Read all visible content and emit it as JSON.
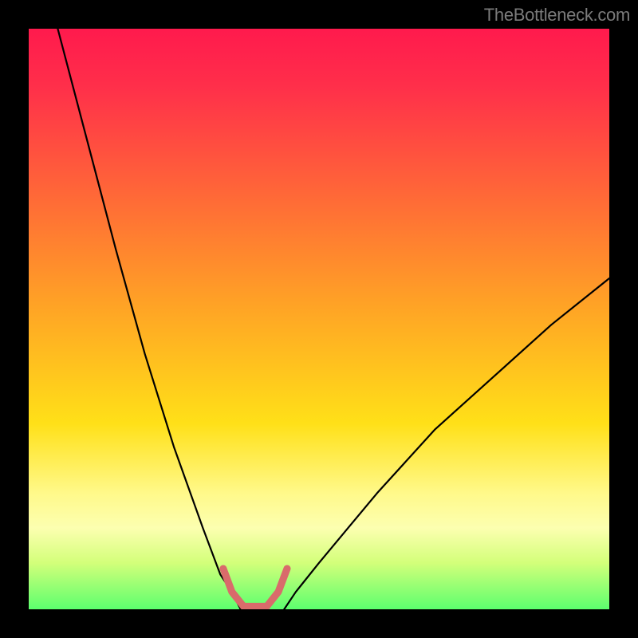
{
  "watermark": "TheBottleneck.com",
  "chart_data": {
    "type": "line",
    "title": "",
    "xlabel": "",
    "ylabel": "",
    "xlim": [
      0,
      100
    ],
    "ylim": [
      0,
      100
    ],
    "grid": false,
    "legend": false,
    "note": "Axes have no visible numeric ticks or labels; values below are estimated from pixel positions where 0,0 is bottom-left of the gradient square and 100,100 is top-right.",
    "series": [
      {
        "name": "left-curve",
        "x": [
          5,
          10,
          15,
          20,
          25,
          30,
          33,
          35,
          36.5
        ],
        "y": [
          100,
          81,
          62,
          44,
          28,
          14,
          6,
          3,
          0
        ],
        "stroke": "#000000",
        "width": 2.2
      },
      {
        "name": "right-curve",
        "x": [
          44,
          46,
          50,
          55,
          60,
          70,
          80,
          90,
          100
        ],
        "y": [
          0,
          3,
          8,
          14,
          20,
          31,
          40,
          49,
          57
        ],
        "stroke": "#000000",
        "width": 2.2
      },
      {
        "name": "bottom-bracket",
        "x": [
          33.5,
          35,
          37,
          39,
          41,
          43,
          44.5
        ],
        "y": [
          7,
          3,
          0.5,
          0.5,
          0.5,
          3,
          7
        ],
        "stroke": "#d96b6b",
        "width": 9
      }
    ],
    "gradient_stops": [
      {
        "pos": 0,
        "color": "#ff1a4d"
      },
      {
        "pos": 10,
        "color": "#ff2f4a"
      },
      {
        "pos": 28,
        "color": "#ff6638"
      },
      {
        "pos": 48,
        "color": "#ffa425"
      },
      {
        "pos": 68,
        "color": "#ffe018"
      },
      {
        "pos": 80,
        "color": "#fff98a"
      },
      {
        "pos": 86,
        "color": "#fcffb0"
      },
      {
        "pos": 92,
        "color": "#d3ff7a"
      },
      {
        "pos": 100,
        "color": "#5cff6e"
      }
    ]
  }
}
